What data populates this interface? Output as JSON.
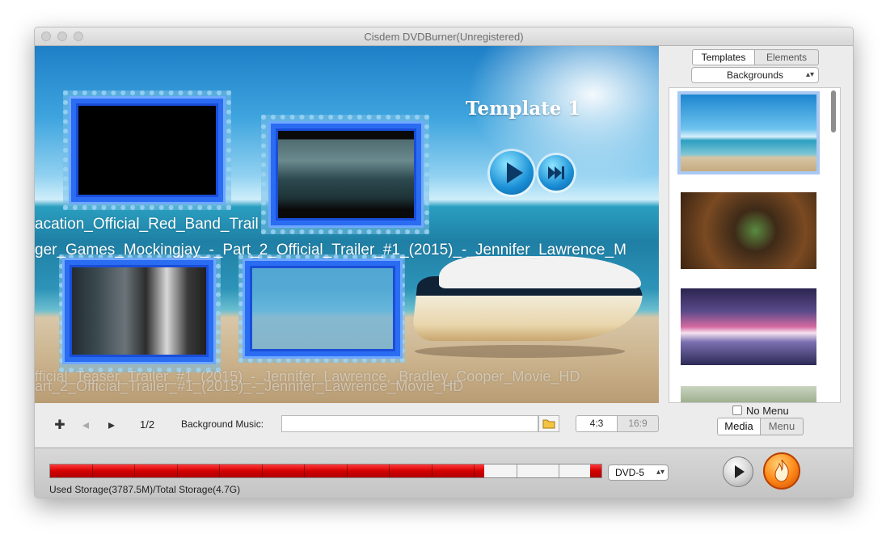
{
  "window": {
    "title": "Cisdem DVDBurner(Unregistered)"
  },
  "preview": {
    "template_title": "Template 1",
    "overlay_texts": [
      "acation_Official_Red_Band_Trail",
      "ger_Games_Mockingjay_-_Part_2_Official_Trailer_#1_(2015)_-_Jennifer_Lawrence_M",
      "fficial_Teaser_Trailer_#1_(2015)_-_Jennifer_Lawrence,_Bradley_Cooper_Movie_HD",
      "art_2_Official_Trailer_#1_(2015)_-_Jennifer_Lawrence_Movie_HD"
    ]
  },
  "toolbar": {
    "add_icon": "plus-icon",
    "prev_icon": "arrow-left-icon",
    "next_icon": "arrow-right-icon",
    "page_indicator": "1/2",
    "background_music_label": "Background Music:",
    "background_music_value": "",
    "folder_icon": "folder-icon",
    "aspect_options": [
      "4:3",
      "16:9"
    ],
    "aspect_selected": "4:3"
  },
  "sidebar": {
    "tabs": [
      "Templates",
      "Elements"
    ],
    "selected_tab": "Templates",
    "category": "Backgrounds",
    "thumbnails_count_visible": 4,
    "no_menu_label": "No Menu",
    "no_menu_checked": false,
    "mode_tabs": [
      "Media",
      "Menu"
    ],
    "selected_mode": "Media"
  },
  "bottom": {
    "storage_text": "Used Storage(3787.5M)/Total Storage(4.7G)",
    "storage_fraction": 0.787,
    "disc_type": "DVD-5",
    "preview_icon": "play-icon",
    "burn_icon": "flame-icon"
  }
}
